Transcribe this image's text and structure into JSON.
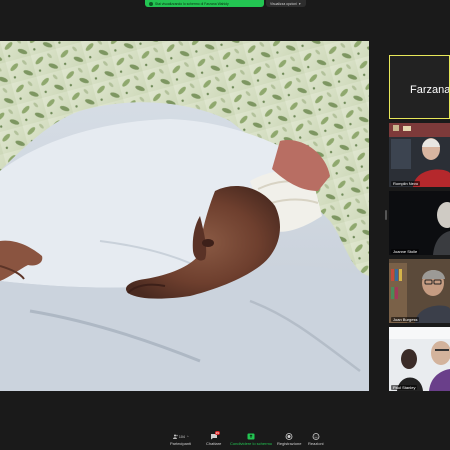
{
  "share_banner": {
    "text": "Stai visualizzando lo schermo di Farzana Wahidy",
    "view_options": "Visualizza opzioni"
  },
  "gallery": {
    "active_speaker": "Farzana",
    "participants": [
      {
        "name": "Farzana"
      },
      {
        "name": "Romplin Nevo"
      },
      {
        "name": "Joanne Stolle"
      },
      {
        "name": "Joan Burgess"
      },
      {
        "name": "Paul Stanley"
      }
    ]
  },
  "toolbar": {
    "participants_label": "Partecipanti",
    "participants_count": "104",
    "chat_label": "Chattare",
    "chat_badge": "39",
    "share_label": "Condividere lo schermo",
    "record_label": "Registrazione",
    "reactions_label": "Reazioni"
  },
  "colors": {
    "share_green": "#23c552",
    "active_tile_border": "#e8e85a",
    "toolbar_bg": "#1a1a1a"
  }
}
